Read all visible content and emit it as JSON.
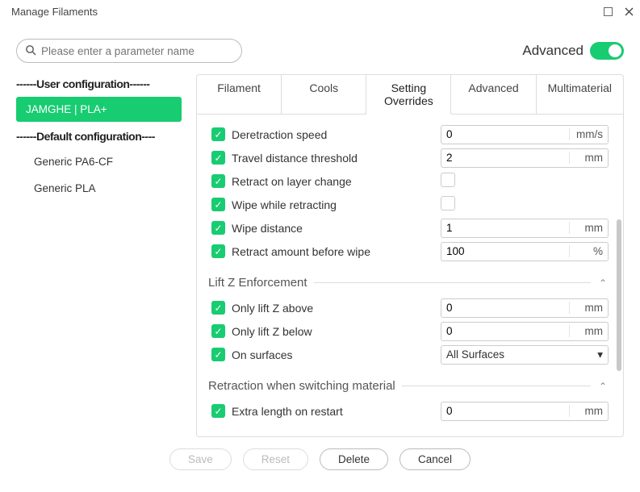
{
  "window": {
    "title": "Manage Filaments"
  },
  "search": {
    "placeholder": "Please enter a parameter name"
  },
  "advanced": {
    "label": "Advanced",
    "on": true
  },
  "sidebar": {
    "user_header": "------User configuration------",
    "default_header": "------Default configuration----",
    "user_items": [
      {
        "label": "JAMGHE | PLA+",
        "active": true
      }
    ],
    "default_items": [
      {
        "label": "Generic PA6-CF"
      },
      {
        "label": "Generic PLA"
      }
    ]
  },
  "tabs": [
    {
      "label": "Filament"
    },
    {
      "label": "Cools"
    },
    {
      "label": "Setting Overrides",
      "active": true
    },
    {
      "label": "Advanced"
    },
    {
      "label": "Multimaterial"
    }
  ],
  "settings": [
    {
      "label": "Deretraction speed",
      "value": "0",
      "unit": "mm/s"
    },
    {
      "label": "Travel distance threshold",
      "value": "2",
      "unit": "mm"
    },
    {
      "label": "Retract on layer change",
      "type": "check",
      "checked": false
    },
    {
      "label": "Wipe while retracting",
      "type": "check",
      "checked": false
    },
    {
      "label": "Wipe distance",
      "value": "1",
      "unit": "mm"
    },
    {
      "label": "Retract amount before wipe",
      "value": "100",
      "unit": "%"
    }
  ],
  "liftz": {
    "title": "Lift Z Enforcement",
    "rows": [
      {
        "label": "Only lift Z above",
        "value": "0",
        "unit": "mm"
      },
      {
        "label": "Only lift Z below",
        "value": "0",
        "unit": "mm"
      },
      {
        "label": "On surfaces",
        "type": "dropdown",
        "value": "All Surfaces"
      }
    ]
  },
  "retraction_switch": {
    "title": "Retraction when switching material",
    "rows": [
      {
        "label": "Extra length on restart",
        "value": "0",
        "unit": "mm"
      }
    ]
  },
  "footer": {
    "save": "Save",
    "reset": "Reset",
    "delete": "Delete",
    "cancel": "Cancel"
  }
}
